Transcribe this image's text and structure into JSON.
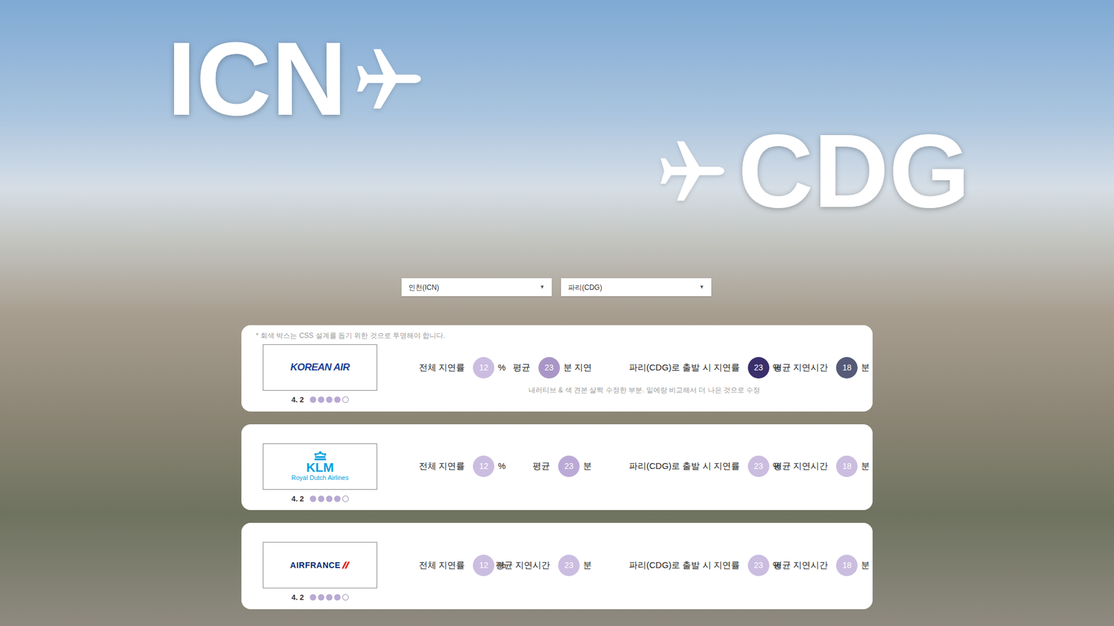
{
  "title": {
    "origin": "ICN",
    "destination": "CDG"
  },
  "selectors": [
    {
      "value": "인천(ICN)",
      "arrow": "▼"
    },
    {
      "value": "파리(CDG)",
      "arrow": "▼"
    }
  ],
  "design_note": "* 회색 박스는 CSS 설계를 돕기 위한 것으로 투명해야 합니다.",
  "airlines": [
    {
      "logo": {
        "kind": "koreanair",
        "lines": [
          "KOREAN AIR"
        ]
      },
      "rating": "4. 2",
      "stars": 4,
      "stats": [
        {
          "label": "전체 지연률",
          "value": "12",
          "unit": "%",
          "color": "#cbbde0"
        },
        {
          "label": "평균",
          "value": "23",
          "unit": "분 지연",
          "color": "#a996c6"
        },
        {
          "label": "파리(CDG)로 출발 시 지연률",
          "value": "23",
          "unit": "%",
          "color": "#3a2f6b"
        },
        {
          "label": "평균 지연시간",
          "value": "18",
          "unit": "분",
          "color": "#565a78"
        }
      ],
      "note": "내러티브 & 색 견본 살짝 수정한 부분. 밑에랑 비교해서 더 나은 것으로 수정"
    },
    {
      "logo": {
        "kind": "klm",
        "lines": [
          "KLM",
          "Royal Dutch Airlines"
        ]
      },
      "rating": "4. 2",
      "stars": 4,
      "stats": [
        {
          "label": "전체 지연률",
          "value": "12",
          "unit": "%",
          "color": "#cbbde0"
        },
        {
          "label": "평균",
          "value": "23",
          "unit": "분",
          "color": "#bba9d6"
        },
        {
          "label": "파리(CDG)로 출발 시 지연률",
          "value": "23",
          "unit": "%",
          "color": "#cbbde0"
        },
        {
          "label": "평균 지연시간",
          "value": "18",
          "unit": "분",
          "color": "#cbbde0"
        }
      ]
    },
    {
      "logo": {
        "kind": "airfrance",
        "lines": [
          "AIRFRANCE"
        ]
      },
      "rating": "4. 2",
      "stars": 4,
      "stats": [
        {
          "label": "전체 지연률",
          "value": "12",
          "unit": "%",
          "color": "#cbbde0"
        },
        {
          "label": "평균 지연시간",
          "value": "23",
          "unit": "분",
          "color": "#cbbde0"
        },
        {
          "label": "파리(CDG)로 출발 시 지연률",
          "value": "23",
          "unit": "%",
          "color": "#cbbde0"
        },
        {
          "label": "평균 지연시간",
          "value": "18",
          "unit": "분",
          "color": "#cbbde0"
        }
      ]
    }
  ]
}
